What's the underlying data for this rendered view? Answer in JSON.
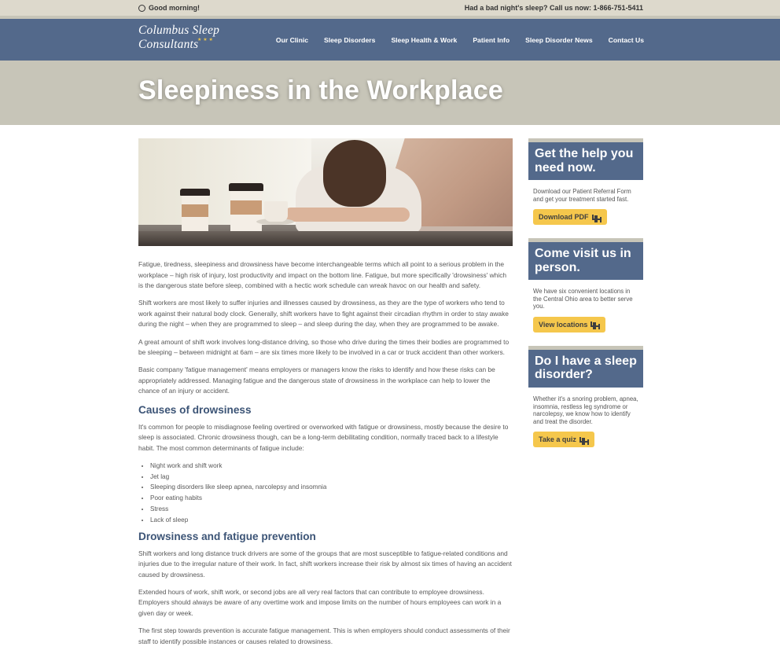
{
  "topbar": {
    "greeting": "Good morning!",
    "call_text": "Had a bad night's sleep? Call us now: 1-866-751-5411"
  },
  "header": {
    "logo": "Columbus Sleep Consultants",
    "logo_stars": "★ ★ ★",
    "nav": [
      "Our Clinic",
      "Sleep Disorders",
      "Sleep Health & Work",
      "Patient Info",
      "Sleep Disorder News",
      "Contact Us"
    ]
  },
  "banner": {
    "title": "Sleepiness in the Workplace"
  },
  "hero": {
    "image_label": "photo"
  },
  "article": {
    "paragraphs": [
      "Fatigue, tiredness, sleepiness and drowsiness have become interchangeable terms which all point to a serious problem in the workplace – high risk of injury, lost productivity and impact on the bottom line.  Fatigue, but more specifically 'drowsiness' which is the dangerous state before sleep, combined with a hectic work schedule can wreak havoc on our health and safety.",
      "Shift workers are most likely to suffer injuries and illnesses caused by drowsiness, as they are the type of workers who tend to work against their natural body clock. Generally, shift workers have to fight against their circadian rhythm in order to stay awake during the night – when they are programmed to sleep – and sleep during the day, when they are programmed to be awake.",
      "A great amount of shift work involves long-distance driving, so those who drive during the times their bodies are programmed to be sleeping – between midnight at 6am – are six times more likely to be involved in a car or truck accident than other workers.",
      "Basic company 'fatigue management' means employers or managers know the risks to identify and how these risks can be appropriately addressed. Managing fatigue and the dangerous state of drowsiness in the workplace can help to lower the chance of an injury or accident."
    ],
    "section1": {
      "heading": "Causes of drowsiness",
      "paragraph": "It's common for people to misdiagnose feeling overtired or overworked with fatigue or drowsiness, mostly because the desire to sleep is associated. Chronic drowsiness though, can be a long-term debilitating condition, normally traced back to a lifestyle habit. The most common determinants of fatigue include:",
      "list": [
        "Night work and shift work",
        "Jet lag",
        "Sleeping disorders like sleep apnea, narcolepsy and insomnia",
        "Poor eating habits",
        "Stress",
        "Lack of sleep"
      ]
    },
    "section2": {
      "heading": "Drowsiness and fatigue prevention",
      "paragraphs": [
        "Shift workers and long distance truck drivers are some of the groups that are most susceptible to fatigue-related conditions and injuries due to the irregular nature of their work. In fact, shift workers increase their risk by almost six times of having an accident caused by drowsiness.",
        "Extended hours of work, shift work, or second jobs are all very real factors that can contribute to employee drowsiness. Employers should always be aware of any overtime work and impose limits on the number of hours employees can work in a given day or week.",
        "The first step towards prevention is accurate fatigue management. This is when employers should conduct assessments of their staff to identify possible instances or causes related to drowsiness."
      ]
    }
  },
  "sidebar": {
    "cards": [
      {
        "title": "Get the help you need now.",
        "text": "Download our Patient Referral Form and get your treatment started fast.",
        "button": "Download PDF"
      },
      {
        "title": "Come visit us in person.",
        "text": "We have six convenient locations in the Central Ohio area to better serve you.",
        "button": "View locations"
      },
      {
        "title": "Do I have a sleep disorder?",
        "text": "Whether it's a snoring problem, apnea, insomnia, restless leg syndrome or narcolepsy, we know how to identify and treat the disorder.",
        "button": "Take a quiz"
      }
    ]
  },
  "colors": {
    "nav_bg": "#53698b",
    "banner_bg": "#c7c5b8",
    "heading": "#3c5476",
    "button": "#f5c74c"
  }
}
